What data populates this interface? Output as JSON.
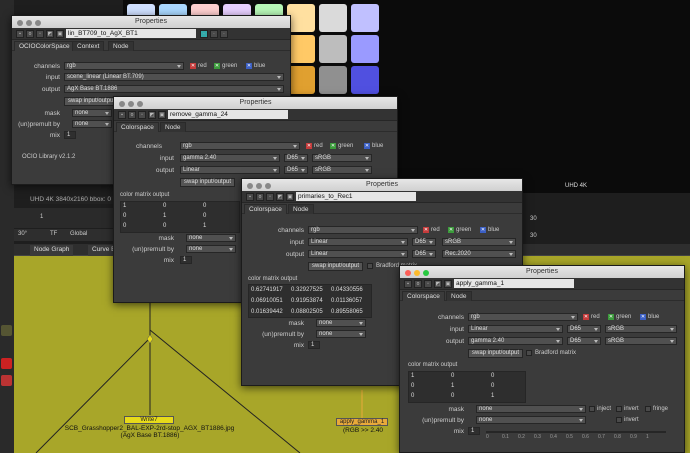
{
  "colors": {
    "accent_red": "#c43b3b",
    "accent_green": "#3b9b3b",
    "accent_blue": "#3b5fc4",
    "nodegraph_bg": "#a8a629",
    "node_yellow": "#e7da1a",
    "node_orange": "#e8a93a"
  },
  "viewer": {
    "info_text": "UHD 4K 3840x2160 bbox: 0 0",
    "label": "UHD 4K"
  },
  "controls": {
    "frame": "1",
    "value_30": "30",
    "angle": "30°",
    "tf": "TF",
    "global": "Global"
  },
  "nodegraph": {
    "tab1": "Node Graph",
    "tab2": "Curve Ed"
  },
  "nodes": {
    "write": {
      "name": "Write7",
      "file": "SCB_Grasshopper2_BAL-EXP-2rd-stop_AGX_BT1886.jpg",
      "sub": "(AgX Base BT.1886)"
    },
    "gamma": {
      "name": "apply_gamma_1",
      "sub": "(RGB >> 2.40"
    }
  },
  "windows": [
    {
      "title": "Properties",
      "node_name": "lin_BT709_to_AgX_BT1",
      "tabs": [
        "OCIOColorSpace",
        "Context",
        "Node"
      ],
      "channels_label": "channels",
      "channels": "rgb",
      "red": "red",
      "green": "green",
      "blue": "blue",
      "input_label": "input",
      "input": "scene_linear (Linear BT.709)",
      "output_label": "output",
      "output": "AgX Base BT.1886",
      "swap": "swap input/output",
      "mask_label": "mask",
      "mask": "none",
      "premult_label": "(un)premult by",
      "premult": "none",
      "mix_label": "mix",
      "mix": "1",
      "library": "OCIO Library v2.1.2"
    },
    {
      "title": "Properties",
      "node_name": "remove_gamma_24",
      "tabs": [
        "Colorspace",
        "Node"
      ],
      "channels_label": "channels",
      "channels": "rgb",
      "red": "red",
      "green": "green",
      "blue": "blue",
      "input_label": "input",
      "input": "gamma 2.40",
      "input_wp": "D65",
      "input_prim": "sRGB",
      "output_label": "output",
      "output": "Linear",
      "output_wp": "D65",
      "output_prim": "sRGB",
      "swap": "swap input/output",
      "matrix_label": "color matrix output",
      "matrix": [
        [
          "1",
          "0",
          "0"
        ],
        [
          "0",
          "1",
          "0"
        ],
        [
          "0",
          "0",
          "1"
        ]
      ],
      "mask_label": "mask",
      "mask": "none",
      "premult_label": "(un)premult by",
      "premult": "none",
      "mix_label": "mix",
      "mix": "1"
    },
    {
      "title": "Properties",
      "node_name": "primaries_to_Rec1",
      "tabs": [
        "Colorspace",
        "Node"
      ],
      "channels_label": "channels",
      "channels": "rgb",
      "red": "red",
      "green": "green",
      "blue": "blue",
      "input_label": "input",
      "input": "Linear",
      "input_wp": "D65",
      "input_prim": "sRGB",
      "output_label": "output",
      "output": "Linear",
      "output_wp": "D65",
      "output_prim": "Rec.2020",
      "swap": "swap input/output",
      "bradford": "Bradford matrix",
      "matrix_label": "color matrix output",
      "matrix": [
        [
          "0.62741917",
          "0.32927525",
          "0.04330556"
        ],
        [
          "0.06910051",
          "0.91953874",
          "0.01136057"
        ],
        [
          "0.01639442",
          "0.08802505",
          "0.89558065"
        ]
      ],
      "mask_label": "mask",
      "mask": "none",
      "premult_label": "(un)premult by",
      "premult": "none",
      "mix_label": "mix",
      "mix": "1"
    },
    {
      "title": "Properties",
      "node_name": "apply_gamma_1",
      "tabs": [
        "Colorspace",
        "Node"
      ],
      "channels_label": "channels",
      "channels": "rgb",
      "red": "red",
      "green": "green",
      "blue": "blue",
      "input_label": "input",
      "input": "Linear",
      "input_wp": "D65",
      "input_prim": "sRGB",
      "output_label": "output",
      "output": "gamma 2.40",
      "output_wp": "D65",
      "output_prim": "sRGB",
      "swap": "swap input/output",
      "bradford": "Bradford matrix",
      "matrix_label": "color matrix output",
      "matrix": [
        [
          "1",
          "0",
          "0"
        ],
        [
          "0",
          "1",
          "0"
        ],
        [
          "0",
          "0",
          "1"
        ]
      ],
      "mask_label": "mask",
      "mask": "none",
      "inject": "inject",
      "invert": "invert",
      "fringe": "fringe",
      "premult_label": "(un)premult by",
      "premult": "none",
      "invert2": "invert",
      "mix_label": "mix",
      "mix": "1",
      "ticks": [
        "0",
        "0.1",
        "0.2",
        "0.3",
        "0.4",
        "0.5",
        "0.6",
        "0.7",
        "0.8",
        "0.9",
        "1"
      ]
    }
  ]
}
